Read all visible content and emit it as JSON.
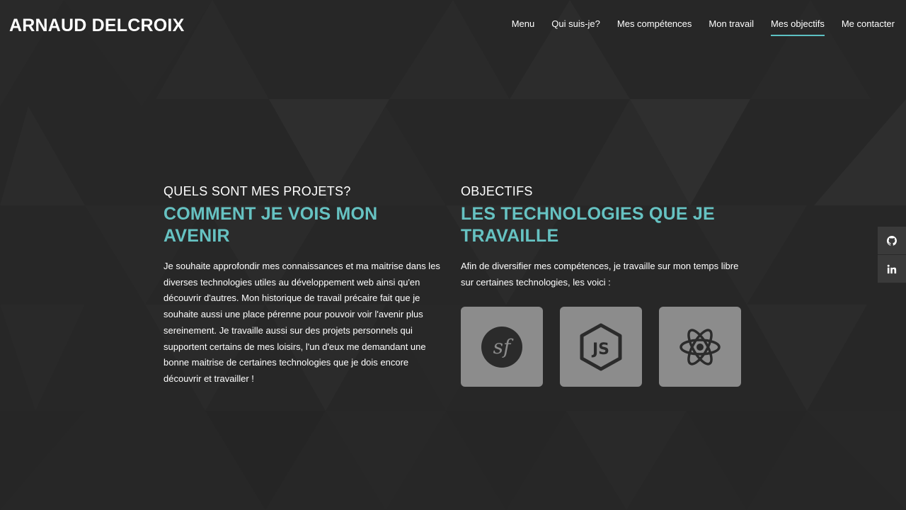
{
  "brand": "ARNAUD DELCROIX",
  "nav": [
    {
      "label": "Menu",
      "active": false
    },
    {
      "label": "Qui suis-je?",
      "active": false
    },
    {
      "label": "Mes compétences",
      "active": false
    },
    {
      "label": "Mon travail",
      "active": false
    },
    {
      "label": "Mes objectifs",
      "active": true
    },
    {
      "label": "Me contacter",
      "active": false
    }
  ],
  "left": {
    "eyebrow": "QUELS SONT MES PROJETS?",
    "heading": "COMMENT JE VOIS MON AVENIR",
    "text": "Je souhaite approfondir mes connaissances et ma maitrise dans les diverses technologies utiles au développement web ainsi qu'en découvrir d'autres. Mon historique de travail précaire fait que je souhaite aussi une place pérenne pour pouvoir voir l'avenir plus sereinement. Je travaille aussi sur des projets personnels qui supportent certains de mes loisirs, l'un d'eux me demandant une bonne maitrise de certaines technologies que je dois encore découvrir et travailler !"
  },
  "right": {
    "eyebrow": "OBJECTIFS",
    "heading": "LES TECHNOLOGIES QUE JE TRAVAILLE",
    "text": "Afin de diversifier mes compétences, je travaille sur mon temps libre sur certaines technologies, les voici :"
  },
  "technologies": [
    {
      "icon": "symfony-icon"
    },
    {
      "icon": "nodejs-icon"
    },
    {
      "icon": "react-icon"
    }
  ],
  "social": [
    {
      "icon": "github-icon"
    },
    {
      "icon": "linkedin-icon"
    }
  ],
  "colors": {
    "accent": "#66c2c2",
    "background": "#282828",
    "card": "#8c8c8c"
  }
}
